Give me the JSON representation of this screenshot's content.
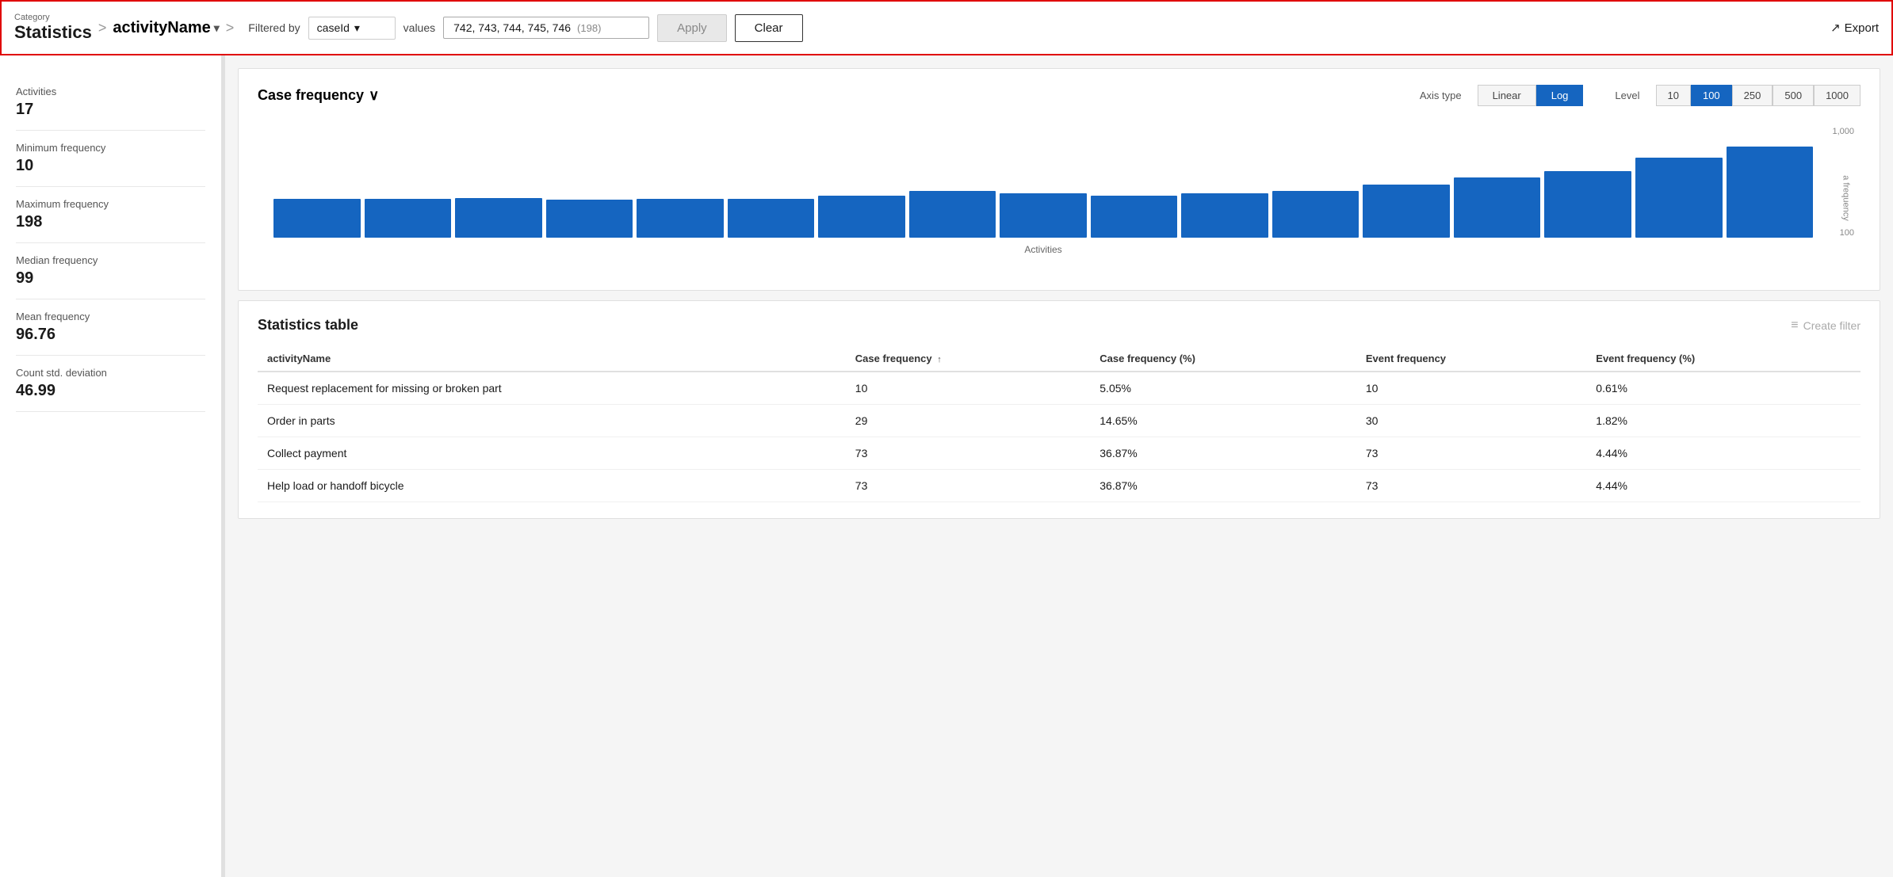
{
  "header": {
    "category_label": "Category",
    "breadcrumb_root": "Statistics",
    "breadcrumb_sep1": ">",
    "breadcrumb_activity": "activityName",
    "breadcrumb_sep2": ">",
    "filtered_by_label": "Filtered by",
    "filter_field": "caseId",
    "filter_field_chevron": "▾",
    "values_label": "values",
    "values_text": "742, 743, 744, 745, 746",
    "values_count": "(198)",
    "apply_label": "Apply",
    "clear_label": "Clear",
    "export_label": "Export",
    "export_icon": "→"
  },
  "sidebar": {
    "stats": [
      {
        "label": "Activities",
        "value": "17"
      },
      {
        "label": "Minimum frequency",
        "value": "10"
      },
      {
        "label": "Maximum frequency",
        "value": "198"
      },
      {
        "label": "Median frequency",
        "value": "99"
      },
      {
        "label": "Mean frequency",
        "value": "96.76"
      },
      {
        "label": "Count std. deviation",
        "value": "46.99"
      }
    ]
  },
  "chart": {
    "title": "Case frequency",
    "title_chevron": "∨",
    "axis_type_label": "Axis type",
    "axis_buttons": [
      {
        "label": "Linear",
        "active": false
      },
      {
        "label": "Log",
        "active": true
      }
    ],
    "level_label": "Level",
    "level_buttons": [
      {
        "label": "10",
        "active": false
      },
      {
        "label": "100",
        "active": true
      },
      {
        "label": "250",
        "active": false
      },
      {
        "label": "500",
        "active": false
      },
      {
        "label": "1000",
        "active": false
      }
    ],
    "x_axis_label": "Activities",
    "y_labels": [
      "1,000",
      "100"
    ],
    "freq_label": "a frequency",
    "bars": [
      35,
      35,
      35,
      35,
      35,
      35,
      40,
      42,
      40,
      38,
      42,
      42,
      50,
      55,
      60,
      70,
      80
    ]
  },
  "table": {
    "title": "Statistics table",
    "create_filter_label": "Create filter",
    "columns": [
      {
        "label": "activityName"
      },
      {
        "label": "Case frequency",
        "sort": "↑"
      },
      {
        "label": "Case frequency (%)"
      },
      {
        "label": "Event frequency"
      },
      {
        "label": "Event frequency (%)"
      }
    ],
    "rows": [
      {
        "activity": "Request replacement for missing or broken part",
        "case_freq": "10",
        "case_freq_pct": "5.05%",
        "event_freq": "10",
        "event_freq_pct": "0.61%"
      },
      {
        "activity": "Order in parts",
        "case_freq": "29",
        "case_freq_pct": "14.65%",
        "event_freq": "30",
        "event_freq_pct": "1.82%"
      },
      {
        "activity": "Collect payment",
        "case_freq": "73",
        "case_freq_pct": "36.87%",
        "event_freq": "73",
        "event_freq_pct": "4.44%"
      },
      {
        "activity": "Help load or handoff bicycle",
        "case_freq": "73",
        "case_freq_pct": "36.87%",
        "event_freq": "73",
        "event_freq_pct": "4.44%"
      }
    ]
  }
}
